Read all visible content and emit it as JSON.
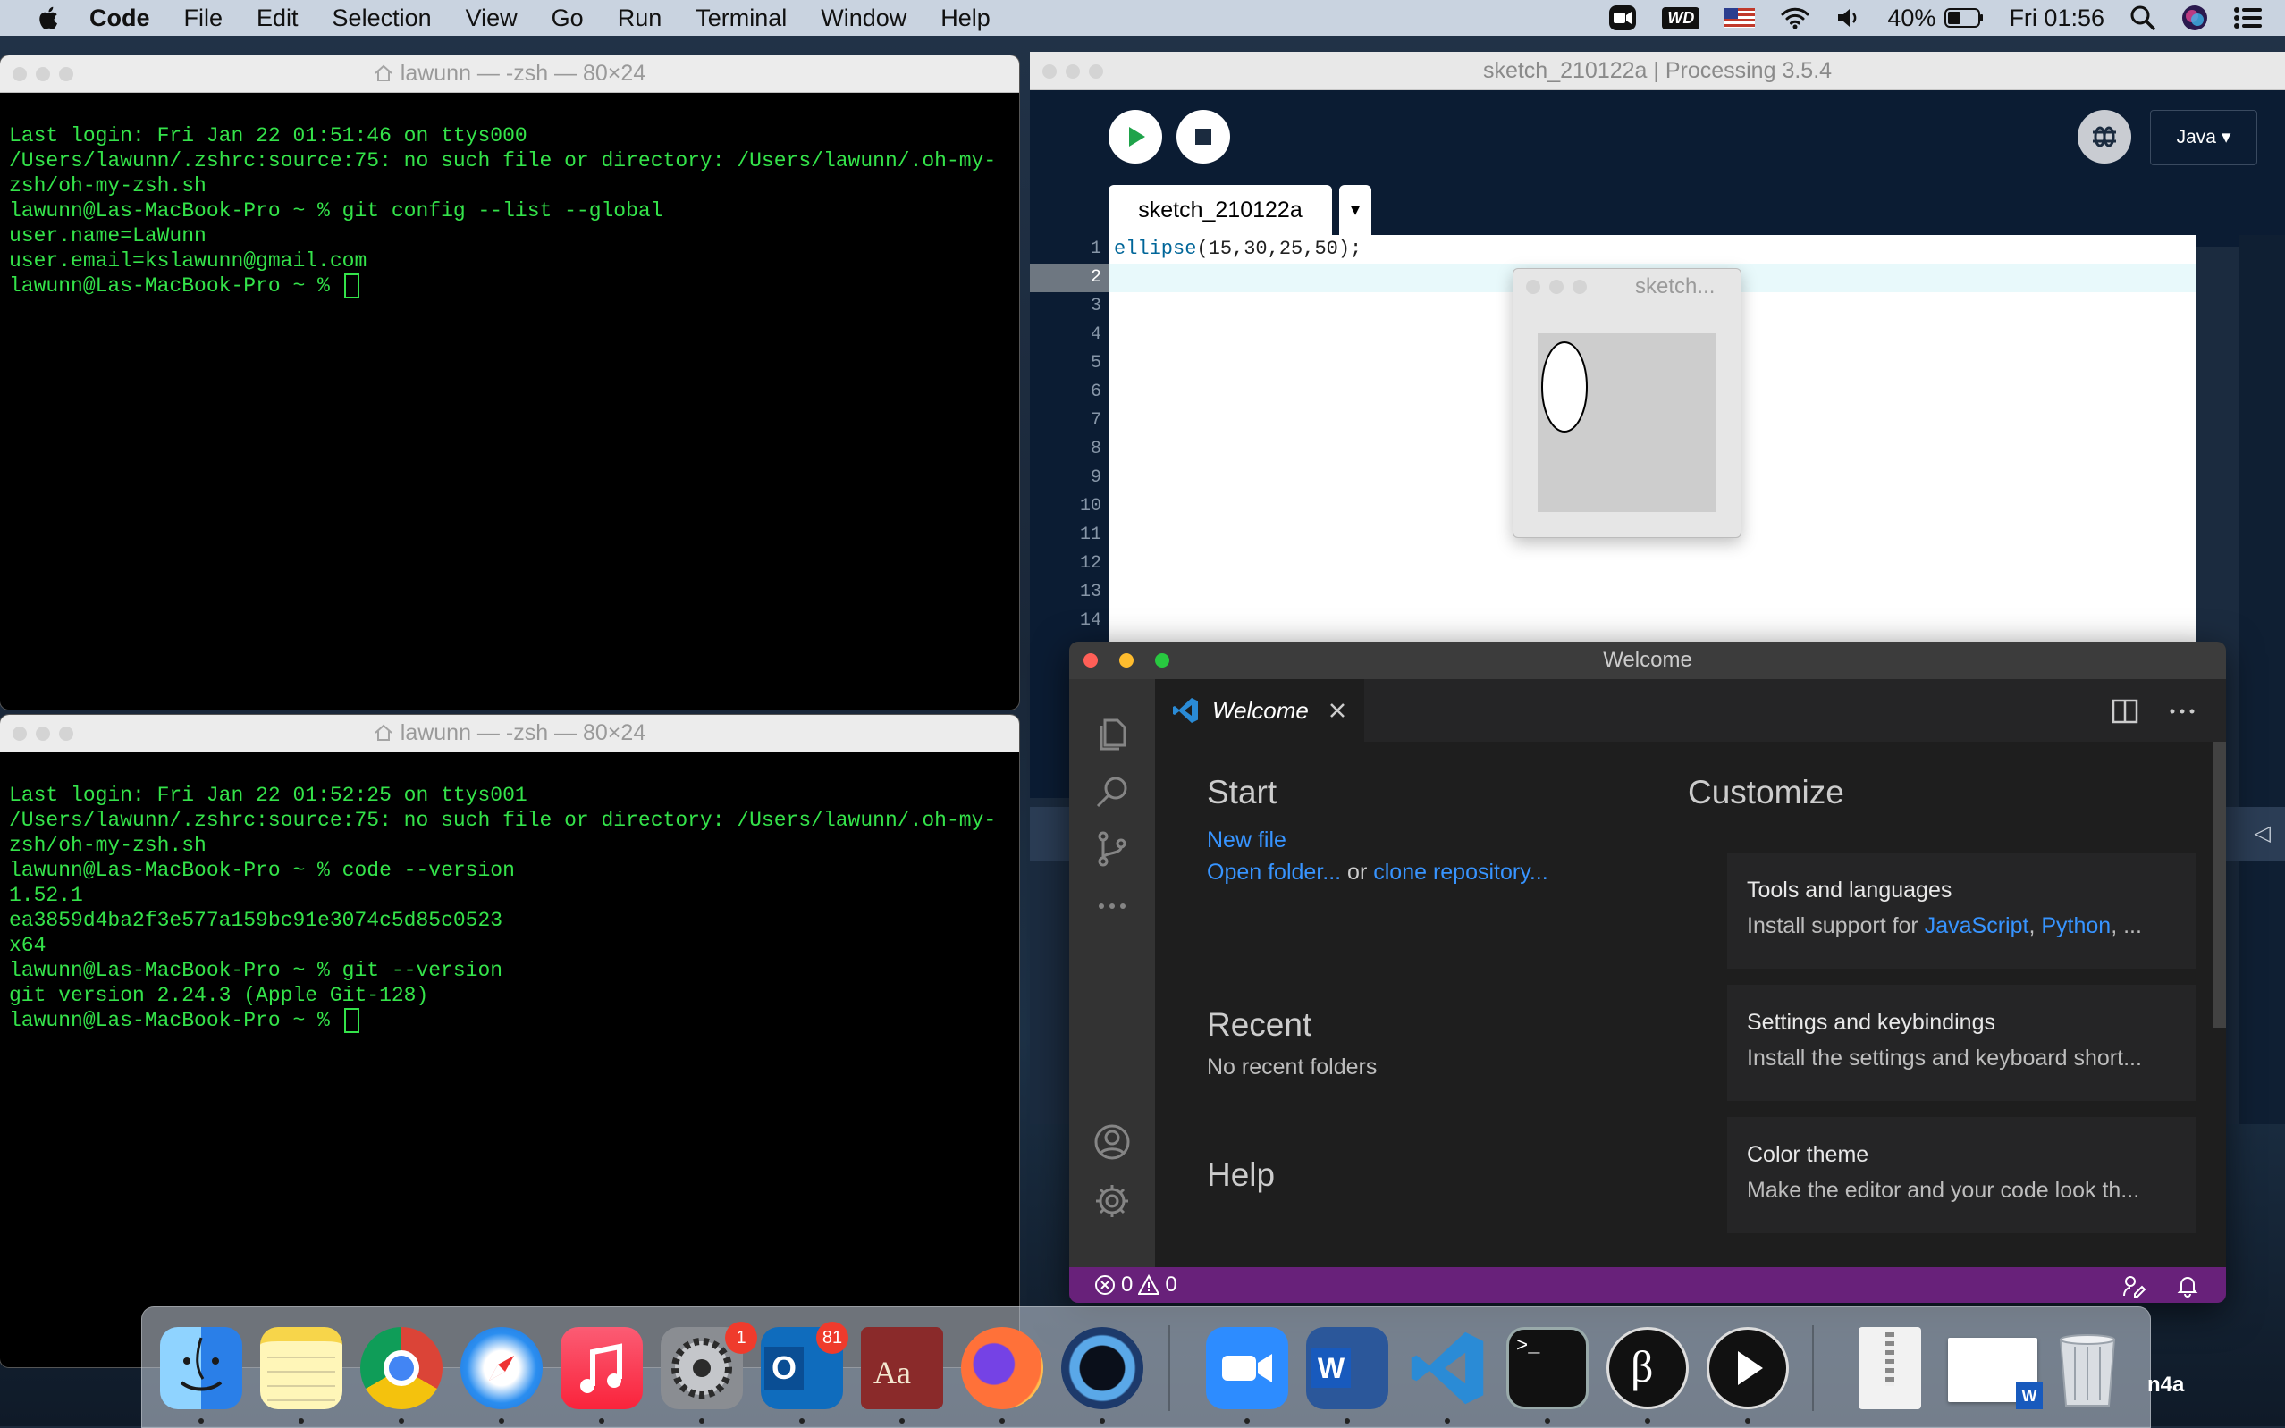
{
  "menubar": {
    "app": "Code",
    "items": [
      "File",
      "Edit",
      "Selection",
      "View",
      "Go",
      "Run",
      "Terminal",
      "Window",
      "Help"
    ],
    "battery": "40%",
    "clock": "Fri 01:56",
    "wd_label": "WD"
  },
  "terminal_top": {
    "title": "lawunn — -zsh — 80×24",
    "lines": [
      "Last login: Fri Jan 22 01:51:46 on ttys000",
      "/Users/lawunn/.zshrc:source:75: no such file or directory: /Users/lawunn/.oh-my-",
      "zsh/oh-my-zsh.sh",
      "lawunn@Las-MacBook-Pro ~ % git config --list --global",
      "user.name=LaWunn",
      "user.email=kslawunn@gmail.com"
    ],
    "prompt": "lawunn@Las-MacBook-Pro ~ % "
  },
  "terminal_bottom": {
    "title": "lawunn — -zsh — 80×24",
    "lines": [
      "Last login: Fri Jan 22 01:52:25 on ttys001",
      "/Users/lawunn/.zshrc:source:75: no such file or directory: /Users/lawunn/.oh-my-",
      "zsh/oh-my-zsh.sh",
      "lawunn@Las-MacBook-Pro ~ % code --version",
      "1.52.1",
      "ea3859d4ba2f3e577a159bc91e3074c5d85c0523",
      "x64",
      "lawunn@Las-MacBook-Pro ~ % git --version",
      "git version 2.24.3 (Apple Git-128)"
    ],
    "prompt": "lawunn@Las-MacBook-Pro ~ % "
  },
  "processing": {
    "title": "sketch_210122a | Processing 3.5.4",
    "mode": "Java ▾",
    "tab": "sketch_210122a",
    "tab_menu": "▾",
    "code_fn": "ellipse",
    "code_args": "(15,30,25,50);",
    "line_numbers": [
      "1",
      "2",
      "3",
      "4",
      "5",
      "6",
      "7",
      "8",
      "9",
      "10",
      "11",
      "12",
      "13",
      "14"
    ],
    "sketch_title": "sketch..."
  },
  "vscode": {
    "title": "Welcome",
    "tab": "Welcome",
    "start_heading": "Start",
    "new_file": "New file",
    "open_folder": "Open folder...",
    "or": " or ",
    "clone_repo": "clone repository...",
    "recent_heading": "Recent",
    "no_recent": "No recent folders",
    "help_heading": "Help",
    "customize_heading": "Customize",
    "cards": [
      {
        "title": "Tools and languages",
        "desc_pre": "Install support for ",
        "link1": "JavaScript",
        ", ": "",
        "link2": "Python",
        "desc_post": ", ..."
      },
      {
        "title": "Settings and keybindings",
        "desc": "Install the settings and keyboard short..."
      },
      {
        "title": "Color theme",
        "desc": "Make the editor and your code look th..."
      }
    ],
    "status_errors": "0",
    "status_warnings": "0"
  },
  "dock": {
    "badge_prefs": "1",
    "badge_outlook": "81",
    "stray_label": "n4a"
  }
}
